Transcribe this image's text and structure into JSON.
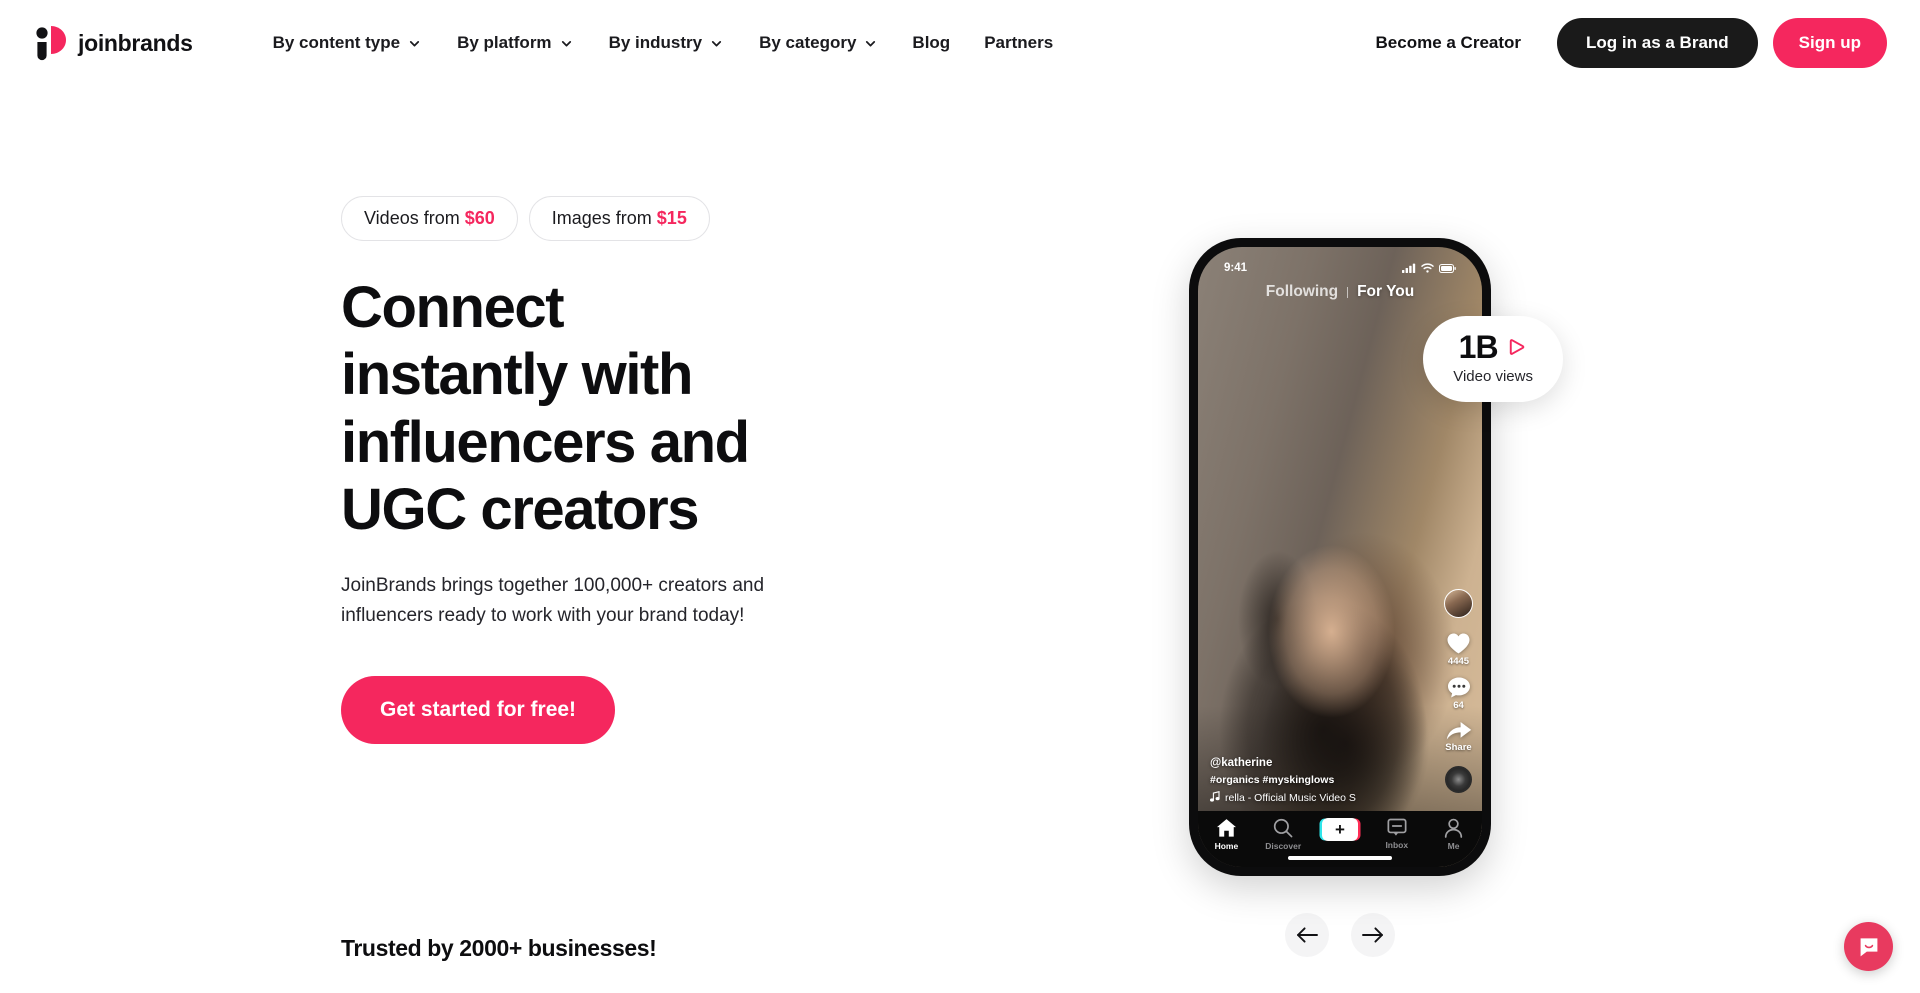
{
  "brand": {
    "name": "joinbrands",
    "logo_icon": "joinbrands-logo-icon",
    "accent_color": "#F5275E",
    "dark_color": "#1a1a1a"
  },
  "nav": {
    "items": [
      {
        "label": "By content type",
        "has_dropdown": true,
        "icon": "chevron-down-icon"
      },
      {
        "label": "By platform",
        "has_dropdown": true,
        "icon": "chevron-down-icon"
      },
      {
        "label": "By industry",
        "has_dropdown": true,
        "icon": "chevron-down-icon"
      },
      {
        "label": "By category",
        "has_dropdown": true,
        "icon": "chevron-down-icon"
      },
      {
        "label": "Blog",
        "has_dropdown": false,
        "icon": ""
      },
      {
        "label": "Partners",
        "has_dropdown": false,
        "icon": ""
      }
    ],
    "become_creator": "Become a Creator",
    "login": "Log in as a Brand",
    "signup": "Sign up"
  },
  "hero": {
    "pills": [
      {
        "text": "Videos from ",
        "price": "$60"
      },
      {
        "text": "Images from ",
        "price": "$15"
      }
    ],
    "headline": "Connect instantly with influencers and UGC creators",
    "subhead": "JoinBrands brings together 100,000+ creators and influencers ready to work with your brand today!",
    "cta": "Get started for free!"
  },
  "phone": {
    "status": {
      "time": "9:41",
      "signal_icon": "cellular-signal-icon",
      "wifi_icon": "wifi-icon",
      "battery_icon": "battery-icon"
    },
    "feed_tabs": [
      {
        "label": "Following",
        "active": false
      },
      {
        "label": "For You",
        "active": true
      }
    ],
    "rail": {
      "avatar_icon": "creator-avatar",
      "like": {
        "icon": "heart-icon",
        "count": "4445"
      },
      "comment": {
        "icon": "comment-bubble-icon",
        "count": "64"
      },
      "share": {
        "icon": "share-arrow-icon",
        "label": "Share"
      },
      "disc_icon": "music-disc-icon"
    },
    "caption": {
      "username": "@katherine",
      "hashtags": "#organics #myskinglows",
      "music_icon": "music-note-icon",
      "music": "rella - Official Music Video S"
    },
    "tabbar": [
      {
        "label": "Home",
        "icon": "home-icon",
        "active": true
      },
      {
        "label": "Discover",
        "icon": "search-icon",
        "active": false
      },
      {
        "label": "",
        "icon": "plus-icon",
        "active": false
      },
      {
        "label": "Inbox",
        "icon": "inbox-icon",
        "active": false
      },
      {
        "label": "Me",
        "icon": "person-icon",
        "active": false
      }
    ]
  },
  "views_badge": {
    "value": "1B",
    "play_icon": "play-triangle-icon",
    "label": "Video views"
  },
  "carousel": {
    "prev_icon": "arrow-left-icon",
    "next_icon": "arrow-right-icon"
  },
  "trusted": {
    "text": "Trusted by 2000+ businesses!"
  },
  "chat": {
    "icon": "chat-bubble-smile-icon",
    "color": "#E83A5F"
  }
}
